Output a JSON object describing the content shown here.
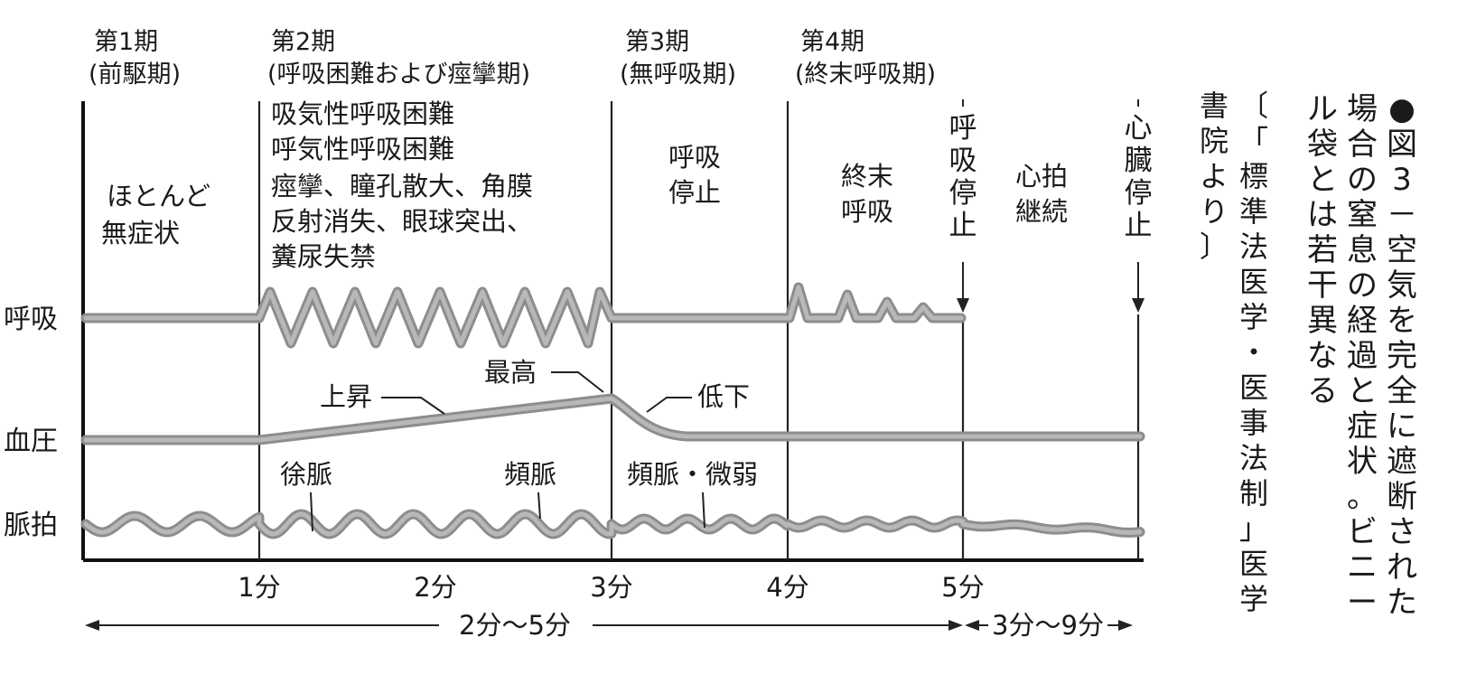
{
  "phases": [
    {
      "title": "第1期",
      "subtitle": "(前駆期)",
      "description": [
        "ほとんど",
        "無症状"
      ]
    },
    {
      "title": "第2期",
      "subtitle": "(呼吸困難および痙攣期)",
      "description": [
        "吸気性呼吸困難",
        "呼気性呼吸困難",
        "痙攣、瞳孔散大、角膜",
        "反射消失、眼球突出、",
        "糞尿失禁"
      ]
    },
    {
      "title": "第3期",
      "subtitle": "(無呼吸期)",
      "description": [
        "呼吸",
        "停止"
      ]
    },
    {
      "title": "第4期",
      "subtitle": "(終末呼吸期)",
      "description": [
        "終末",
        "呼吸"
      ]
    },
    {
      "title": "",
      "subtitle": "",
      "description": [
        "心拍",
        "継続"
      ]
    }
  ],
  "vertical_labels": {
    "respiratory_stop": "呼吸停止",
    "cardiac_stop": "心臓停止"
  },
  "row_labels": {
    "respiration": "呼吸",
    "blood_pressure": "血圧",
    "pulse": "脈拍"
  },
  "annotations": {
    "rise": "上昇",
    "peak": "最高",
    "fall": "低下",
    "bradycardia": "徐脈",
    "tachycardia": "頻脈",
    "tachy_weak": "頻脈・微弱"
  },
  "time_ticks": [
    "1分",
    "2分",
    "3分",
    "4分",
    "5分"
  ],
  "durations": {
    "first": "2分～5分",
    "second": "3分～9分"
  },
  "caption": "●図3－空気を完全に遮断された場合の窒息の経過と症状。ビニール袋とは若干異なる",
  "source": "〔「標準法医学・医事法制」医学書院より〕",
  "colors": {
    "trace": "#8d8d8d",
    "ink": "#1a1a1a"
  }
}
